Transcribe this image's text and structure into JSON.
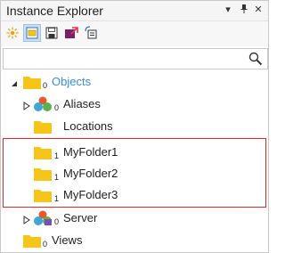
{
  "window": {
    "title": "Instance Explorer",
    "controls": [
      "▾",
      "⊥",
      "✕"
    ]
  },
  "toolbar": {
    "buttons": [
      {
        "name": "sparkle-icon",
        "active": false
      },
      {
        "name": "folder-view-icon",
        "active": true
      },
      {
        "name": "save-icon",
        "active": false
      },
      {
        "name": "export-icon",
        "active": false
      },
      {
        "name": "connect-icon",
        "active": false
      }
    ]
  },
  "search": {
    "value": "",
    "placeholder": ""
  },
  "tree": {
    "items": [
      {
        "label": "Objects",
        "count": "0",
        "icon": "folder-icon",
        "expander": "expanded",
        "selected": true
      },
      {
        "label": "Aliases",
        "count": "0",
        "icon": "aliases-icon",
        "expander": "collapsed"
      },
      {
        "label": "Locations",
        "count": "",
        "icon": "folder-icon",
        "expander": "none"
      },
      {
        "label": "MyFolder1",
        "count": "1",
        "icon": "folder-icon",
        "expander": "none"
      },
      {
        "label": "MyFolder2",
        "count": "1",
        "icon": "folder-icon",
        "expander": "none"
      },
      {
        "label": "MyFolder3",
        "count": "1",
        "icon": "folder-icon",
        "expander": "none"
      },
      {
        "label": "Server",
        "count": "0",
        "icon": "server-icon",
        "expander": "collapsed"
      },
      {
        "label": "Views",
        "count": "0",
        "icon": "folder-icon",
        "expander": "none"
      }
    ]
  },
  "colors": {
    "folder": "#f5c518",
    "selected_text": "#3b8de0",
    "highlight_border": "#e2262b"
  }
}
